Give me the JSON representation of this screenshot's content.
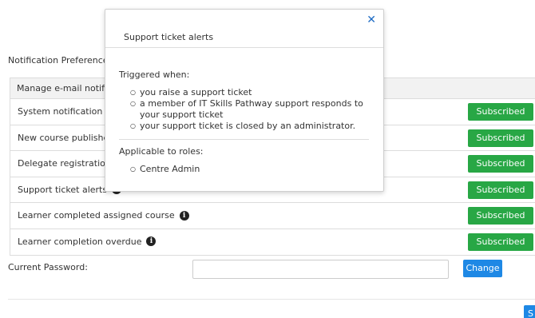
{
  "section_title": "Notification Preferences",
  "table": {
    "header": "Manage e-mail notifications",
    "rows": [
      {
        "label": "System notification added",
        "has_info": false,
        "status": "Subscribed"
      },
      {
        "label": "New course published to",
        "has_info": false,
        "status": "Subscribed"
      },
      {
        "label": "Delegate registration re",
        "has_info": false,
        "status": "Subscribed"
      },
      {
        "label": "Support ticket alerts",
        "has_info": true,
        "status": "Subscribed"
      },
      {
        "label": "Learner completed assigned course",
        "has_info": true,
        "status": "Subscribed"
      },
      {
        "label": "Learner completion overdue",
        "has_info": true,
        "status": "Subscribed"
      }
    ]
  },
  "password": {
    "label": "Current Password:",
    "value": "",
    "change_label": "Change"
  },
  "save_label": "S",
  "popover": {
    "title": "Support ticket alerts",
    "close_icon": "close-icon",
    "triggered_heading": "Triggered when:",
    "triggers": [
      "you raise a support ticket",
      "a member of IT Skills Pathway support responds to your support ticket",
      "your support ticket is closed by an administrator."
    ],
    "roles_heading": "Applicable to roles:",
    "roles": [
      "Centre Admin"
    ]
  },
  "colors": {
    "subscribed": "#28a745",
    "primary": "#1e88e5",
    "close": "#1e6bc4"
  }
}
